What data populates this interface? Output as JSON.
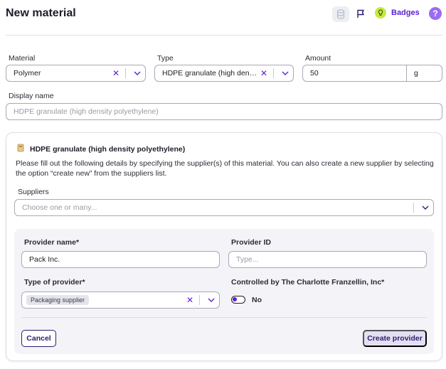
{
  "header": {
    "title": "New material",
    "badges_label": "Badges",
    "help_glyph": "?"
  },
  "material": {
    "label": "Material",
    "value": "Polymer"
  },
  "type": {
    "label": "Type",
    "value": "HDPE granulate (high densit..."
  },
  "amount": {
    "label": "Amount",
    "value": "50",
    "unit": "g"
  },
  "display_name": {
    "label": "Display name",
    "placeholder": "HDPE granulate (high density polyethylene)"
  },
  "supplier_card": {
    "title": "HDPE granulate (high density polyethylene)",
    "description": "Please fill out the following details by specifying the supplier(s) of this material. You can also create a new supplier by selecting the option “create new” from the suppliers list.",
    "suppliers_label": "Suppliers",
    "suppliers_placeholder": "Choose one or many..."
  },
  "provider_form": {
    "name_label": "Provider name*",
    "name_value": "Pack Inc.",
    "id_label": "Provider ID",
    "id_placeholder": "Type...",
    "type_label": "Type of provider*",
    "type_chip": "Packaging supplier",
    "controlled_label": "Controlled by The Charlotte Franzellin, Inc*",
    "controlled_value": "No",
    "cancel_label": "Cancel",
    "create_label": "Create provider"
  },
  "colors": {
    "accent": "#5b21d6",
    "help": "#9a6cf2",
    "bulb": "#c6e93c"
  }
}
